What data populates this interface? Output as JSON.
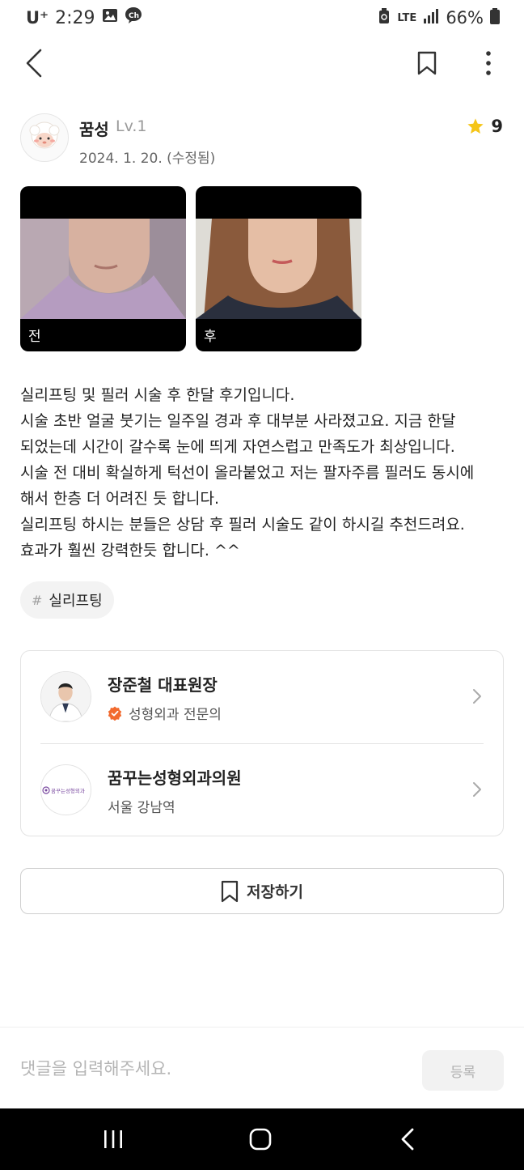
{
  "status_bar": {
    "carrier": "U⁺",
    "time": "2:29",
    "network": "LTE",
    "battery": "66%"
  },
  "header": {
    "back_icon": "back-arrow-icon",
    "bookmark_icon": "bookmark-icon",
    "more_icon": "more-vertical-icon"
  },
  "author": {
    "name": "꿈성",
    "level": "Lv.1",
    "date": "2024. 1. 20. (수정됨)",
    "rating": "9"
  },
  "photos": [
    {
      "label": "전"
    },
    {
      "label": "후"
    }
  ],
  "review": {
    "lines": [
      "실리프팅 및 필러 시술 후 한달 후기입니다.",
      "시술 초반 얼굴 붓기는 일주일 경과 후 대부분 사라졌고요. 지금 한달",
      "되었는데 시간이 갈수록 눈에 띄게 자연스럽고 만족도가 최상입니다.",
      "시술 전 대비 확실하게 턱선이 올라붙었고 저는 팔자주름 필러도 동시에",
      "해서 한층 더 어려진 듯 합니다.",
      "실리프팅 하시는 분들은 상담 후 필러 시술도 같이 하시길 추천드려요.",
      "효과가 훨씬 강력한듯 합니다. ^^"
    ]
  },
  "tag": {
    "hash": "#",
    "label": "실리프팅"
  },
  "doctor": {
    "name": "장준철 대표원장",
    "specialty": "성형외과 전문의",
    "verified_color": "#f26a2e"
  },
  "clinic": {
    "name": "꿈꾸는성형외과의원",
    "location": "서울 강남역",
    "logo_text": "꿈꾸는성형외과"
  },
  "save_button": {
    "label": "저장하기"
  },
  "comment": {
    "placeholder": "댓글을 입력해주세요.",
    "submit_label": "등록"
  },
  "colors": {
    "star": "#f5c518",
    "text_primary": "#222222",
    "text_secondary": "#666666"
  }
}
